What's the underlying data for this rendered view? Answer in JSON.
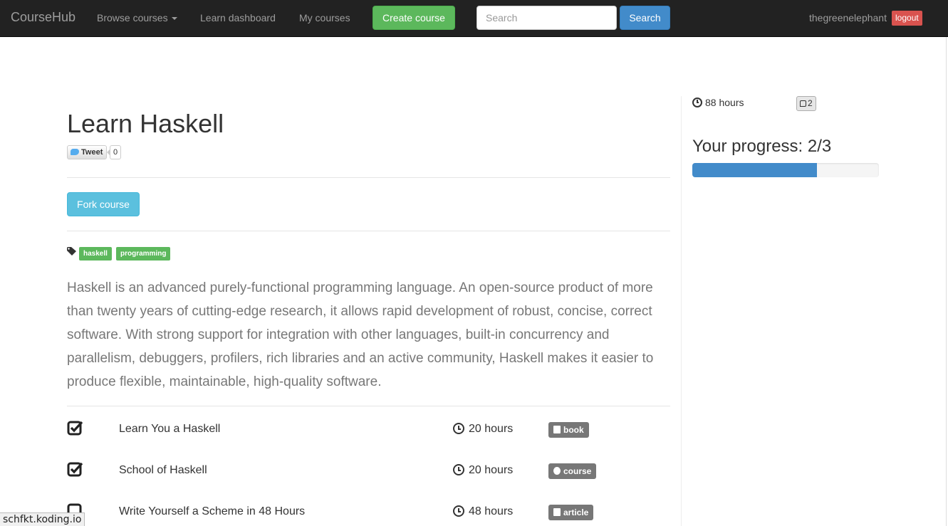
{
  "navbar": {
    "brand": "CourseHub",
    "browse_label": "Browse courses",
    "learn_dashboard": "Learn dashboard",
    "my_courses": "My courses",
    "create_course": "Create course",
    "search_placeholder": "Search",
    "search_button": "Search",
    "username": "thegreenelephant",
    "logout": "logout"
  },
  "course": {
    "title": "Learn Haskell",
    "tweet_label": "Tweet",
    "tweet_count": "0",
    "fork_button": "Fork course",
    "tags": [
      "haskell",
      "programming"
    ],
    "description": "Haskell is an advanced purely-functional programming language. An open-source product of more than twenty years of cutting-edge research, it allows rapid development of robust, concise, correct software. With strong support for integration with other languages, built-in concurrency and parallelism, debuggers, profilers, rich libraries and an active community, Haskell makes it easier to produce flexible, maintainable, high-quality software.",
    "items": [
      {
        "title": "Learn You a Haskell",
        "hours": "20 hours",
        "type": "book",
        "completed": true
      },
      {
        "title": "School of Haskell",
        "hours": "20 hours",
        "type": "course",
        "completed": true
      },
      {
        "title": "Write Yourself a Scheme in 48 Hours",
        "hours": "48 hours",
        "type": "article",
        "completed": false
      }
    ]
  },
  "sidebar": {
    "total_hours": "88 hours",
    "likes": "2",
    "progress_label": "Your progress: 2/3",
    "progress_fraction": 0.667
  },
  "statusbar": {
    "url": "schfkt.koding.io"
  },
  "colors": {
    "navbar_bg": "#222222",
    "success": "#5cb85c",
    "primary": "#428bca",
    "info": "#5bc0de",
    "danger": "#d9534f",
    "badge": "#777777"
  }
}
